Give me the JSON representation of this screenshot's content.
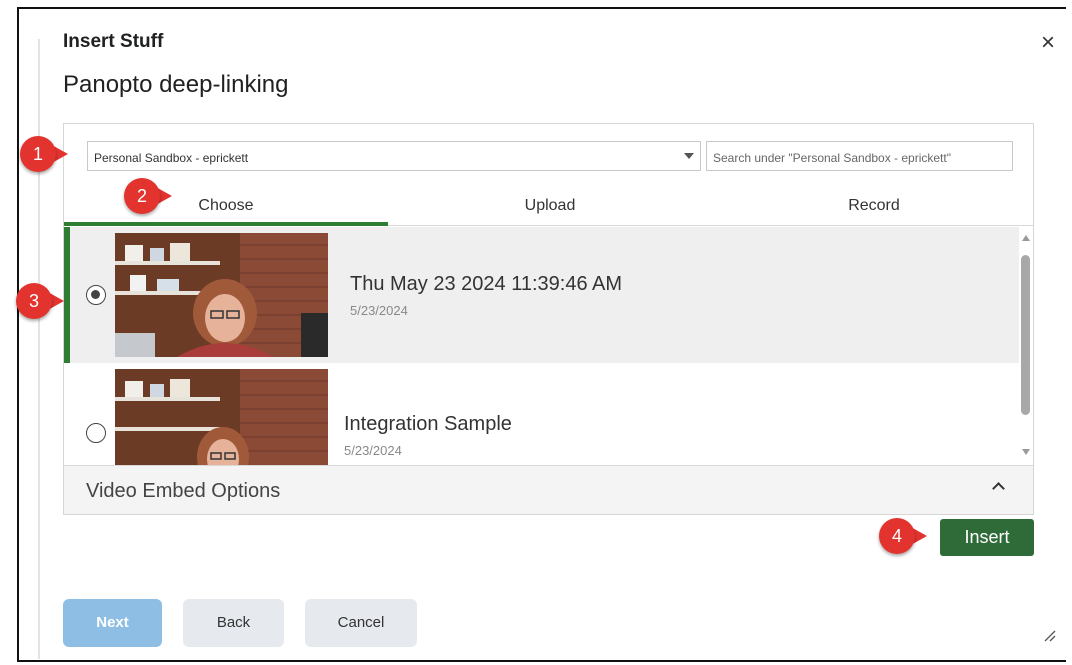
{
  "dialog": {
    "title": "Insert Stuff",
    "subtitle": "Panopto deep-linking",
    "close_label": "×"
  },
  "folder": {
    "selected": "Personal Sandbox - eprickett",
    "search_placeholder": "Search under \"Personal Sandbox - eprickett\""
  },
  "tabs": [
    {
      "label": "Choose",
      "active": true
    },
    {
      "label": "Upload",
      "active": false
    },
    {
      "label": "Record",
      "active": false
    }
  ],
  "videos": [
    {
      "title": "Thu May 23 2024 11:39:46 AM",
      "date": "5/23/2024",
      "selected": true
    },
    {
      "title": "Integration Sample",
      "date": "5/23/2024",
      "selected": false
    }
  ],
  "embed_options_label": "Video Embed Options",
  "insert_label": "Insert",
  "footer": {
    "next_label": "Next",
    "back_label": "Back",
    "cancel_label": "Cancel"
  },
  "callouts": [
    "1",
    "2",
    "3",
    "4"
  ],
  "colors": {
    "accent": "#2e7d32",
    "insert_button": "#2e6b38",
    "next_button": "#8ebee3",
    "callout": "#e2332f"
  }
}
